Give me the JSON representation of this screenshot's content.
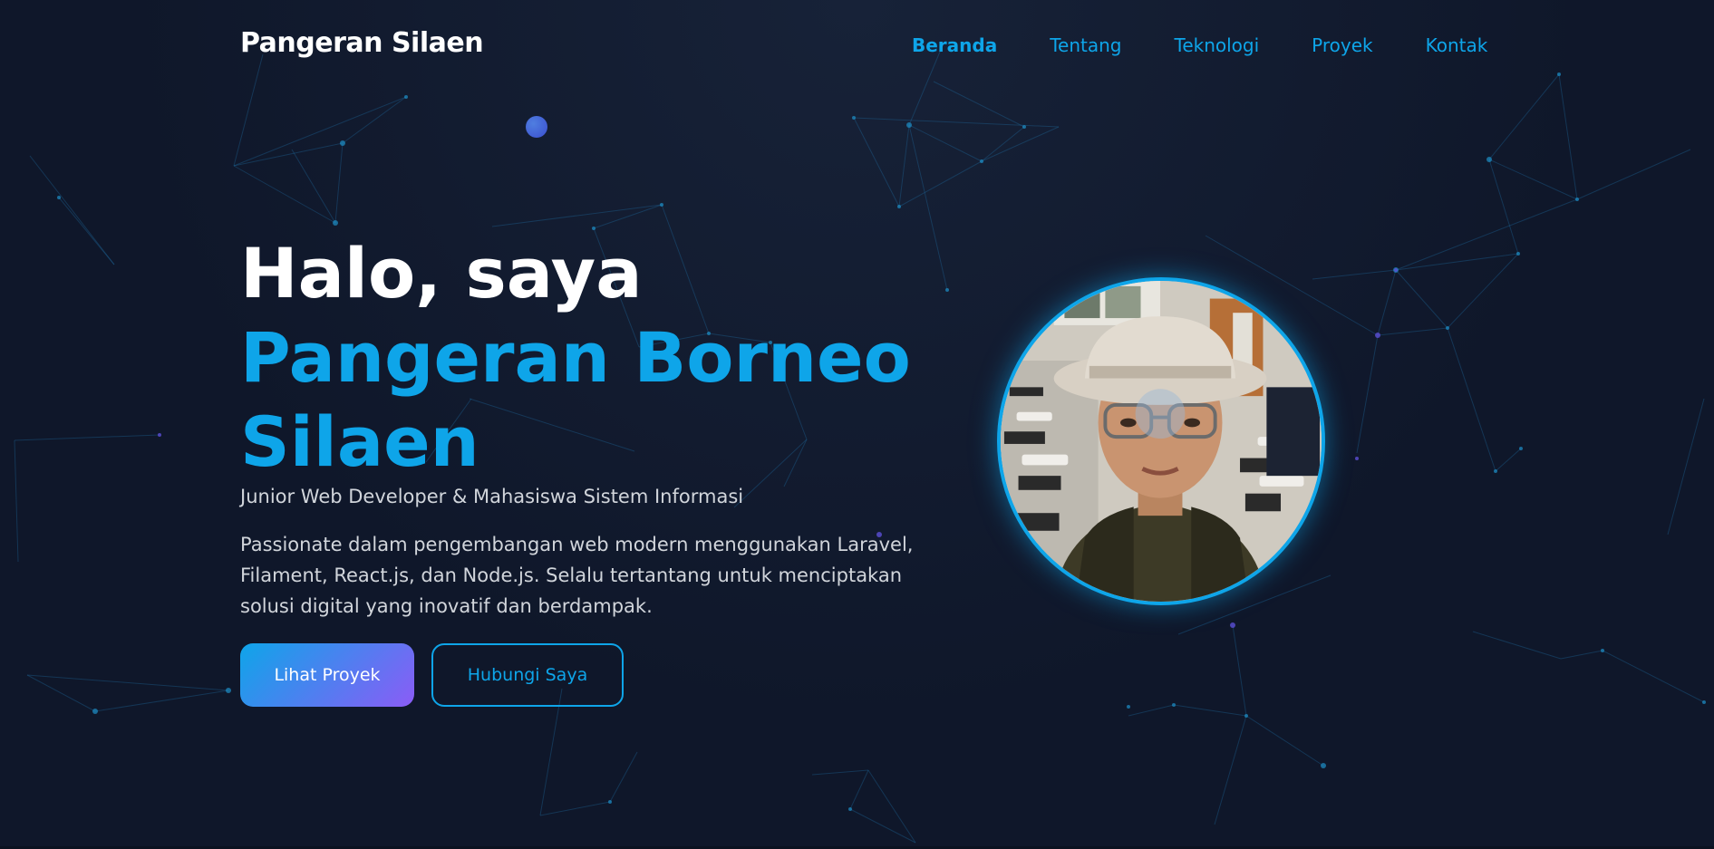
{
  "header": {
    "brand": "Pangeran Silaen",
    "nav": [
      {
        "label": "Beranda",
        "active": true
      },
      {
        "label": "Tentang",
        "active": false
      },
      {
        "label": "Teknologi",
        "active": false
      },
      {
        "label": "Proyek",
        "active": false
      },
      {
        "label": "Kontak",
        "active": false
      }
    ]
  },
  "hero": {
    "greeting": "Halo, saya",
    "name": "Pangeran Borneo Silaen",
    "role": "Junior Web Developer & Mahasiswa Sistem Informasi",
    "description": "Passionate dalam pengembangan web modern menggunakan Laravel, Filament, React.js, dan Node.js. Selalu tertantang untuk menciptakan solusi digital yang inovatif dan berdampak.",
    "primary_button": "Lihat Proyek",
    "secondary_button": "Hubungi Saya"
  },
  "colors": {
    "background": "#0f172a",
    "accent": "#0ea5e9",
    "gradient_end": "#8b5cf6"
  }
}
